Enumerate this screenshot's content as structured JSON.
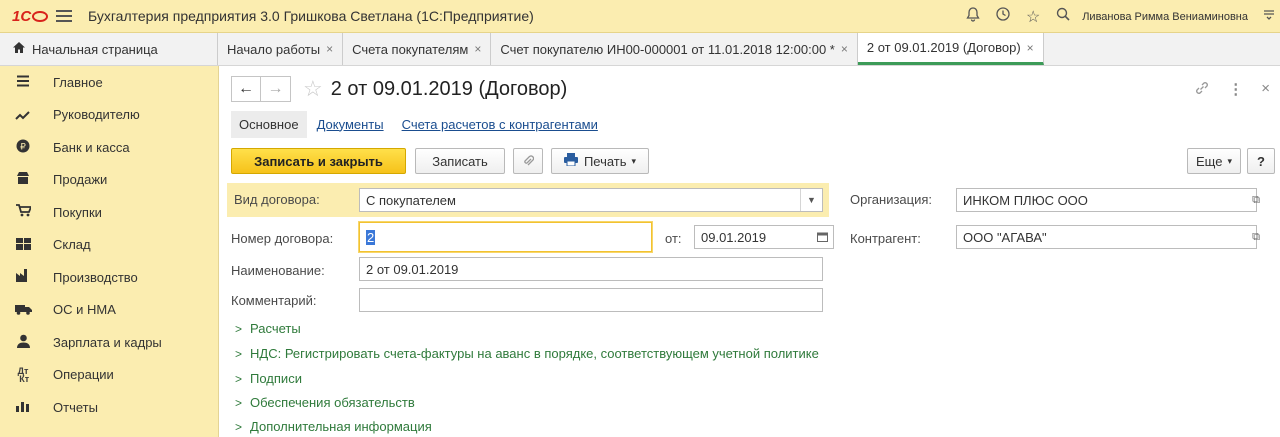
{
  "titlebar": {
    "logo": "1С",
    "app_title": "Бухгалтерия предприятия 3.0 Гришкова Светлана  (1С:Предприятие)",
    "user": "Ливанова Римма Вениаминовна"
  },
  "tabs": {
    "home": "Начальная страница",
    "items": [
      {
        "label": "Начало работы"
      },
      {
        "label": "Счета покупателям"
      },
      {
        "label": "Счет покупателю ИН00-000001 от 11.01.2018 12:00:00 *"
      },
      {
        "label": "2 от 09.01.2019 (Договор)"
      }
    ],
    "close_glyph": "×"
  },
  "sidebar": {
    "items": [
      {
        "label": "Главное",
        "icon": "menu-lines-icon"
      },
      {
        "label": "Руководителю",
        "icon": "trend-icon"
      },
      {
        "label": "Банк и касса",
        "icon": "ruble-coin-icon"
      },
      {
        "label": "Продажи",
        "icon": "shop-icon"
      },
      {
        "label": "Покупки",
        "icon": "cart-icon"
      },
      {
        "label": "Склад",
        "icon": "warehouse-icon"
      },
      {
        "label": "Производство",
        "icon": "factory-icon"
      },
      {
        "label": "ОС и НМА",
        "icon": "truck-icon"
      },
      {
        "label": "Зарплата и кадры",
        "icon": "person-icon"
      },
      {
        "label": "Операции",
        "icon": "dt-kt-icon"
      },
      {
        "label": "Отчеты",
        "icon": "bar-chart-icon"
      }
    ]
  },
  "doc": {
    "title": "2 от 09.01.2019 (Договор)",
    "subtabs": {
      "main": "Основное",
      "documents": "Документы",
      "accounts": "Счета расчетов с контрагентами"
    },
    "toolbar": {
      "save_close": "Записать и закрыть",
      "save": "Записать",
      "print": "Печать",
      "more": "Еще",
      "help": "?"
    },
    "form": {
      "contract_type_label": "Вид договора:",
      "contract_type_value": "С покупателем",
      "org_label": "Организация:",
      "org_value": "ИНКОМ ПЛЮС ООО",
      "number_label": "Номер договора:",
      "number_value": "2",
      "from_label": "от:",
      "date_value": "09.01.2019",
      "counterparty_label": "Контрагент:",
      "counterparty_value": "ООО \"АГАВА\"",
      "name_label": "Наименование:",
      "name_value": "2 от 09.01.2019",
      "comment_label": "Комментарий:",
      "comment_value": ""
    },
    "sections": [
      "Расчеты",
      "НДС: Регистрировать счета-фактуры на аванс в порядке, соответствующем учетной политике",
      "Подписи",
      "Обеспечения обязательств",
      "Дополнительная информация"
    ]
  }
}
